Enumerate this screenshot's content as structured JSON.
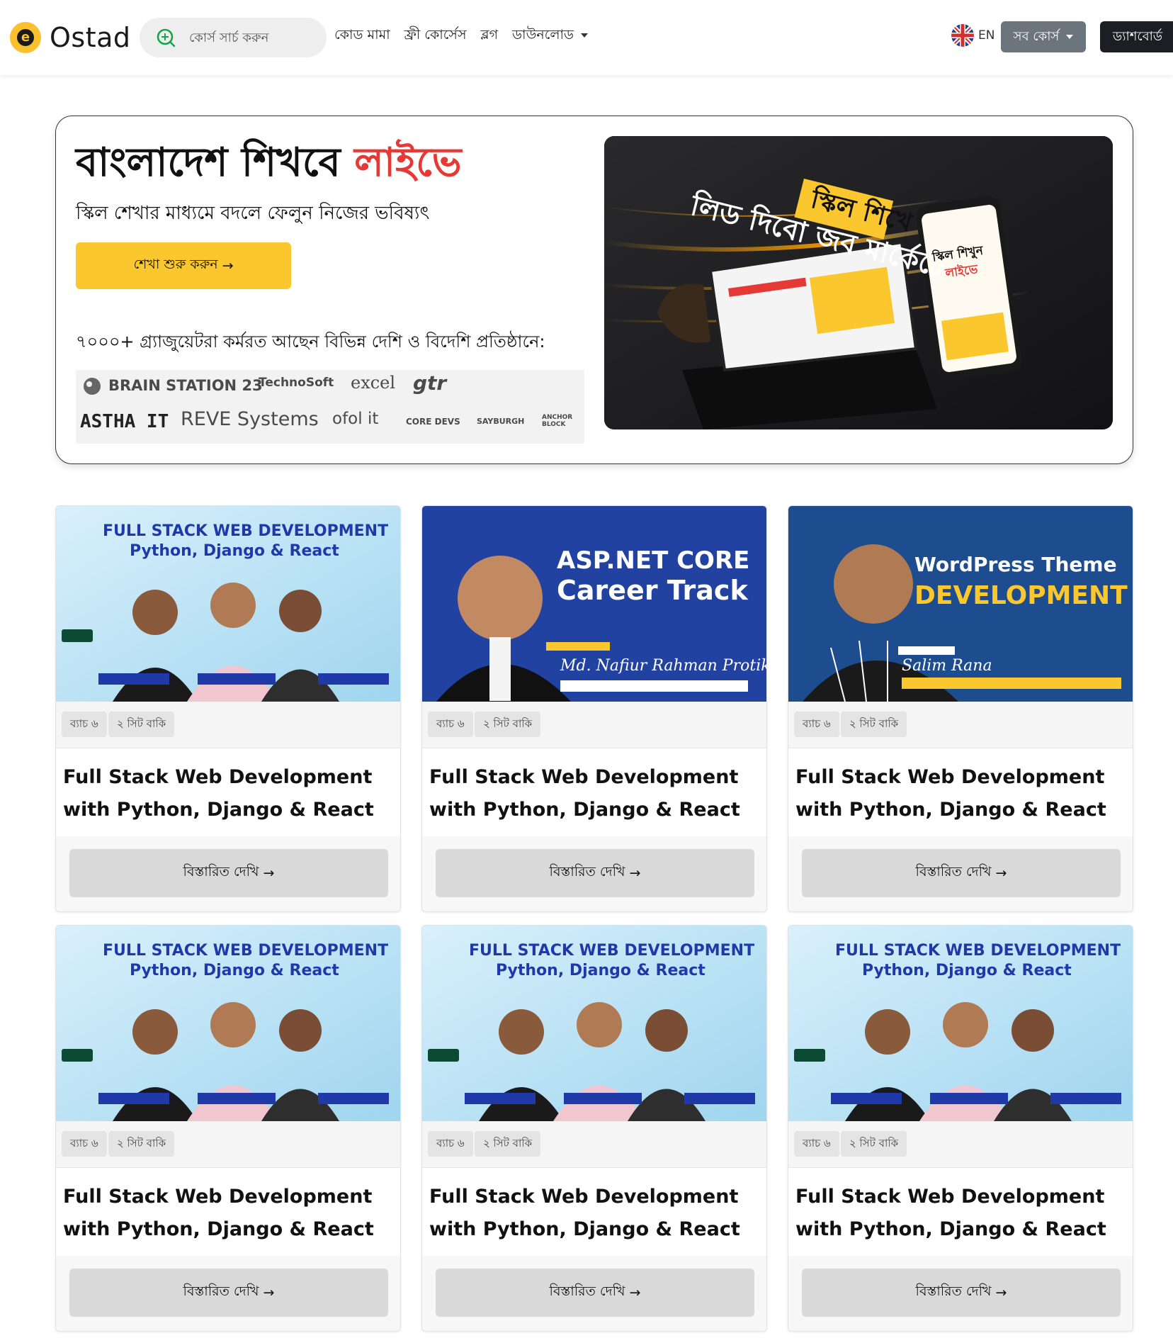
{
  "brand": {
    "name": "Ostad",
    "logo_icon": "ostad-logo-icon"
  },
  "nav": {
    "search_placeholder": "কোর্স সার্চ করুন",
    "links": [
      "কোড মামা",
      "ফ্রী কোর্সেস",
      "ব্লগ",
      "ডাউনলোড"
    ],
    "lang": "EN",
    "all_courses": "সব কোর্স",
    "dashboard": "ড্যাশবোর্ড"
  },
  "hero": {
    "title_main": "বাংলাদেশ শিখবে ",
    "title_accent": "লাইভে",
    "subtitle": "স্কিল শেখার মাধ্যমে বদলে ফেলুন নিজের ভবিষ্যৎ",
    "cta": "শেখা শুরু করুন",
    "cta_arrow": "→",
    "graduates": "৭০০০+ গ্র্যাজুয়েটরা কর্মরত আছেন বিভিন্ন দেশি ও বিদেশি প্রতিষ্ঠানে:",
    "partners": [
      "BRAIN STATION 23",
      "TechnoSoft",
      "excel",
      "gtr",
      "ASTHA IT",
      "REVE Systems",
      "ofol it",
      "CORE DEVS",
      "SAYBURGH",
      "ANCHOR BLOCK"
    ],
    "image_text": {
      "line1": "লিড দিবো জব মার্কেটে",
      "line2": "স্কিল শিখে",
      "phone_1": "স্কিল শিখুন",
      "phone_2": "লাইভে"
    }
  },
  "accent_colors": {
    "yellow": "#fbc72e",
    "red": "#e53935",
    "dark": "#1b1f23"
  },
  "courses": [
    {
      "thumb": {
        "l1": "FULL STACK WEB DEVELOPMENT",
        "l2": "Python, Django & React"
      },
      "batch": "ব্যাচ ৬",
      "seats": "২ সিট বাকি",
      "title": "Full Stack Web Development with Python, Django & React",
      "cta": "বিস্তারিত দেখি",
      "arrow": "→"
    },
    {
      "thumb": {
        "l1": "ASP.NET CORE",
        "l2": "Career Track",
        "instructor": "Md. Nafiur Rahman Protik"
      },
      "batch": "ব্যাচ ৬",
      "seats": "২ সিট বাকি",
      "title": "Full Stack Web Development with Python, Django & React",
      "cta": "বিস্তারিত দেখি",
      "arrow": "→"
    },
    {
      "thumb": {
        "l1": "WordPress Theme",
        "l2": "DEVELOPMENT",
        "instructor": "Salim Rana"
      },
      "batch": "ব্যাচ ৬",
      "seats": "২ সিট বাকি",
      "title": "Full Stack Web Development with Python, Django & React",
      "cta": "বিস্তারিত দেখি",
      "arrow": "→"
    },
    {
      "thumb": {
        "l1": "FULL STACK WEB DEVELOPMENT",
        "l2": "Python, Django & React"
      },
      "batch": "ব্যাচ ৬",
      "seats": "২ সিট বাকি",
      "title": "Full Stack Web Development with Python, Django & React",
      "cta": "বিস্তারিত দেখি",
      "arrow": "→"
    },
    {
      "thumb": {
        "l1": "FULL STACK WEB DEVELOPMENT",
        "l2": "Python, Django & React"
      },
      "batch": "ব্যাচ ৬",
      "seats": "২ সিট বাকি",
      "title": "Full Stack Web Development with Python, Django & React",
      "cta": "বিস্তারিত দেখি",
      "arrow": "→"
    },
    {
      "thumb": {
        "l1": "FULL STACK WEB DEVELOPMENT",
        "l2": "Python, Django & React"
      },
      "batch": "ব্যাচ ৬",
      "seats": "২ সিট বাকি",
      "title": "Full Stack Web Development with Python, Django & React",
      "cta": "বিস্তারিত দেখি",
      "arrow": "→"
    }
  ]
}
